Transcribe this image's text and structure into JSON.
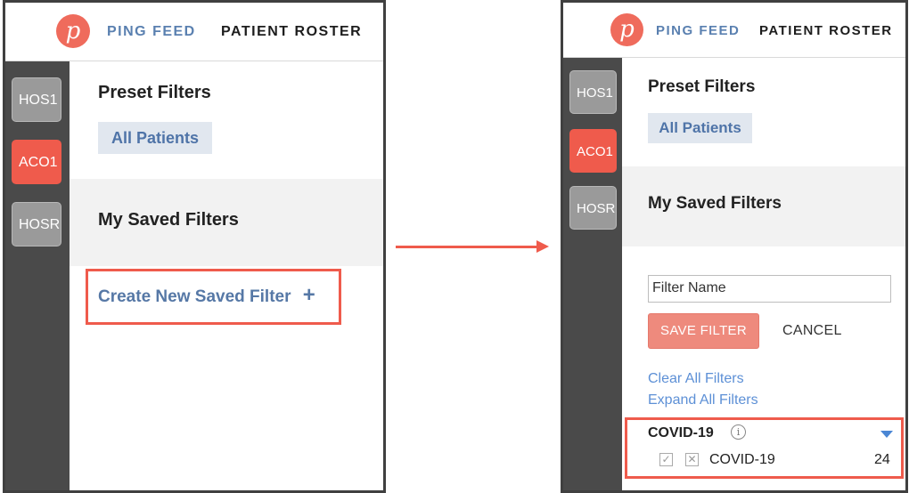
{
  "left": {
    "nav": {
      "feed": "PING FEED",
      "roster": "PATIENT ROSTER",
      "logo_glyph": "p"
    },
    "sidebar": [
      "HOS1",
      "ACO1",
      "HOSRI"
    ],
    "preset_title": "Preset Filters",
    "preset_tag": "All Patients",
    "saved_title": "My Saved Filters",
    "create_label": "Create New Saved Filter",
    "plus": "+"
  },
  "right": {
    "nav": {
      "feed": "PING FEED",
      "roster": "PATIENT ROSTER",
      "logo_glyph": "p"
    },
    "sidebar": [
      "HOS1",
      "ACO1",
      "HOSRI"
    ],
    "preset_title": "Preset Filters",
    "preset_tag": "All Patients",
    "saved_title": "My Saved Filters",
    "filter_placeholder": "Filter Name",
    "save_label": "SAVE FILTER",
    "cancel_label": "CANCEL",
    "clear_label": "Clear All Filters",
    "expand_label": "Expand All Filters",
    "group": {
      "title": "COVID-19",
      "info": "i",
      "item": "COVID-19",
      "count": "24",
      "check": "✓",
      "x": "✕"
    }
  },
  "colors": {
    "accent": "#ef5b4c",
    "link": "#5a80b0",
    "sidebar": "#4a4a4a"
  }
}
